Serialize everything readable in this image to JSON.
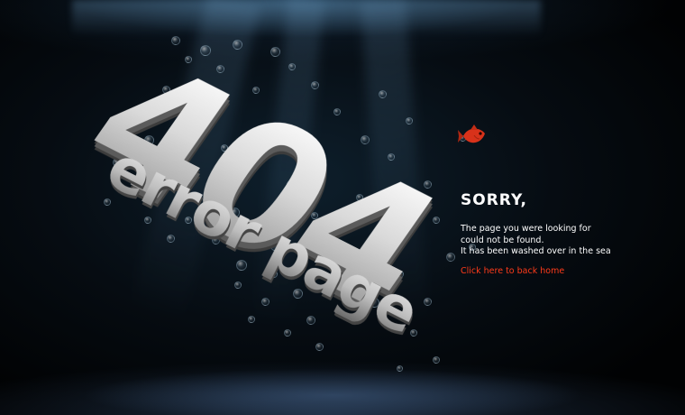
{
  "hero": {
    "code": "404",
    "subtitle": "error page"
  },
  "message": {
    "heading": "SORRY,",
    "lines": [
      "The page you were looking for",
      "could not be found.",
      "It has been washed over in the sea"
    ],
    "link_label": "Click here to back home"
  },
  "colors": {
    "background": "#000000",
    "water_tint": "#0e1f2c",
    "text": "#ffffff",
    "link": "#ff3b1a",
    "fish": "#d8321a"
  },
  "icons": {
    "fish": "red-fish-icon",
    "bubbles": "air-bubble-icon"
  }
}
